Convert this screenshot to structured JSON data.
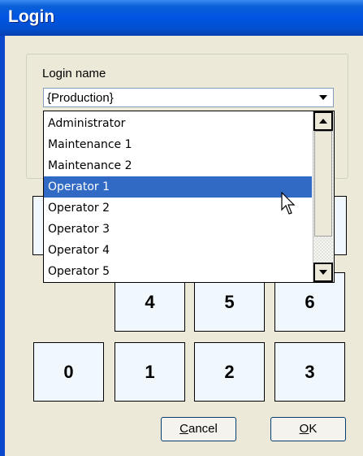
{
  "window": {
    "title": "Login"
  },
  "login": {
    "label": "Login name",
    "selected_value": "{Production}"
  },
  "dropdown": {
    "items": [
      "Administrator",
      "Maintenance 1",
      "Maintenance 2",
      "Operator 1",
      "Operator 2",
      "Operator 3",
      "Operator 4",
      "Operator 5"
    ],
    "highlighted": "Operator 1"
  },
  "keypad": {
    "row2": [
      "4",
      "5",
      "6"
    ],
    "row3": [
      "0",
      "1",
      "2",
      "3"
    ]
  },
  "buttons": {
    "cancel_mnemonic": "C",
    "cancel_rest": "ancel",
    "ok_mnemonic": "O",
    "ok_rest": "K"
  },
  "colors": {
    "title_bar": "#0054e3",
    "selection": "#316ac5",
    "key_face": "#f0f8fe"
  }
}
